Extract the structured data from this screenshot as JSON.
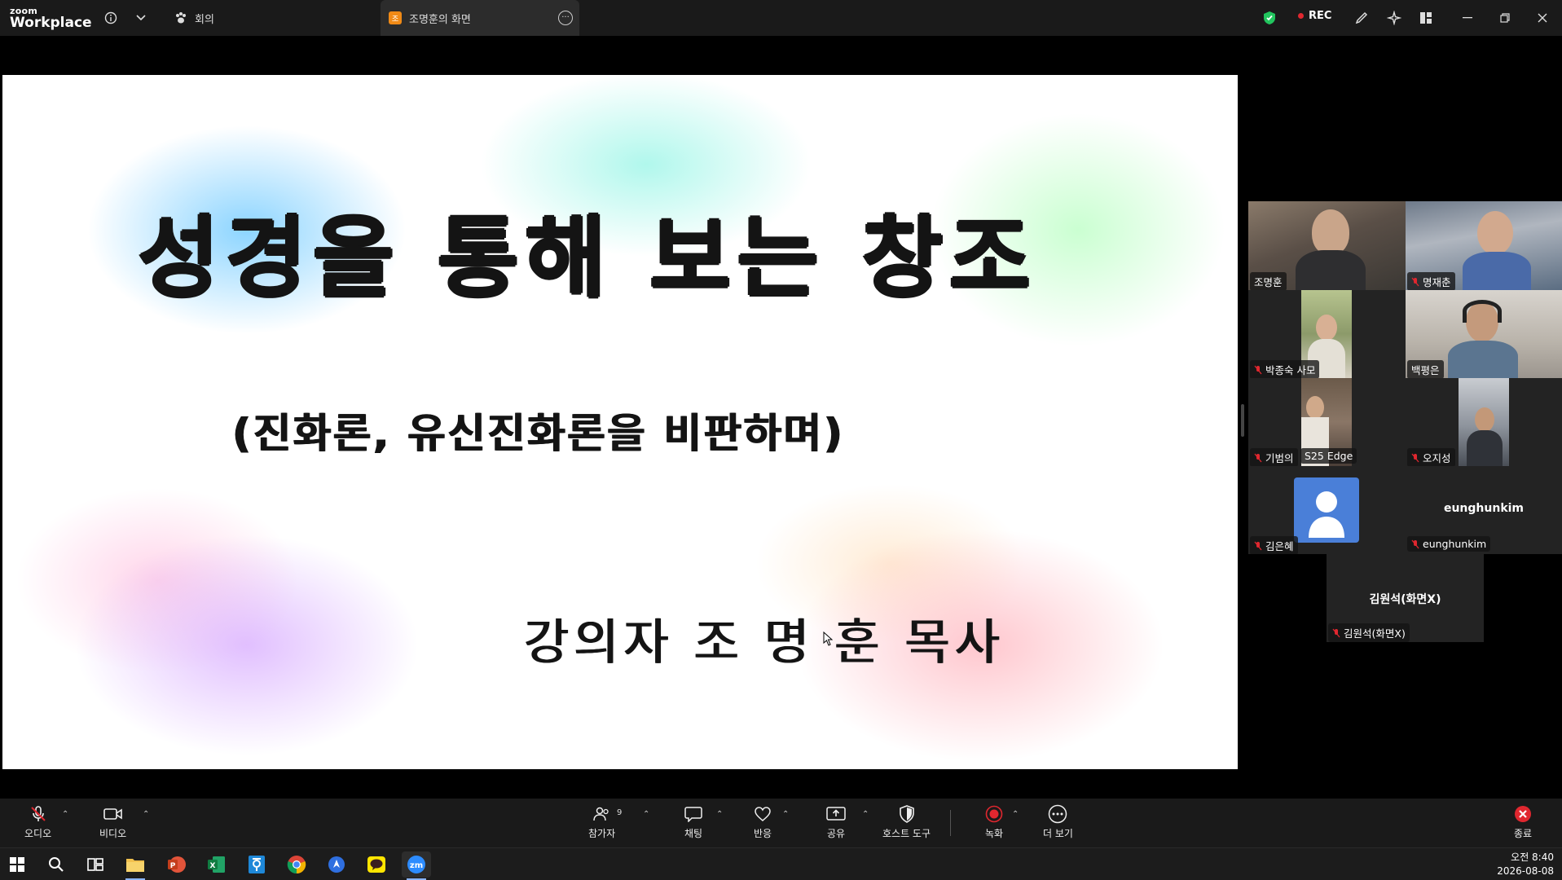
{
  "app": {
    "logo_small": "zoom",
    "logo_big": "Workplace"
  },
  "tabs": {
    "meeting": "회의",
    "share": "조명훈의 화면",
    "share_icon_text": "조"
  },
  "status": {
    "rec": "REC",
    "colors": {
      "rec_dot": "#e0272f",
      "shield": "#22c55e",
      "active_speaker": "#22c55e"
    }
  },
  "slide": {
    "title": "성경을 통해 보는 창조",
    "subtitle": "(진화론, 유신진화론을 비판하며)",
    "lecturer": "강의자  조 명 훈 목사"
  },
  "gallery": [
    {
      "name": "조명훈",
      "muted": false,
      "active": true,
      "video": true
    },
    {
      "name": "명재춘",
      "muted": true,
      "active": false,
      "video": true
    },
    {
      "name": "박종숙 사모",
      "muted": true,
      "active": false,
      "video": true
    },
    {
      "name": "백평은",
      "muted": false,
      "active": false,
      "video": true
    },
    {
      "name": "기범의",
      "extra": "S25 Edge",
      "muted": true,
      "active": false,
      "video": true
    },
    {
      "name": "오지성",
      "muted": true,
      "active": false,
      "video": true
    },
    {
      "name": "김은혜",
      "muted": true,
      "active": false,
      "video": false,
      "avatar": true
    },
    {
      "name": "eunghunkim",
      "center": "eunghunkim",
      "muted": true,
      "active": false,
      "video": false
    },
    {
      "name": "김원석(화면X)",
      "center": "김원석(화면X)",
      "muted": true,
      "active": false,
      "video": false
    }
  ],
  "toolbar": {
    "audio": "오디오",
    "video": "비디오",
    "participants": "참가자",
    "participants_count": "9",
    "chat": "채팅",
    "react": "반응",
    "share": "공유",
    "host_tools": "호스트 도구",
    "record": "녹화",
    "more": "더 보기",
    "end": "종료"
  },
  "taskbar": {
    "time": "오전 8:40",
    "date": "2026-08-08",
    "apps": [
      "windows-start",
      "search",
      "task-view",
      "file-explorer",
      "powerpoint",
      "excel",
      "hangul",
      "chrome",
      "app-blue",
      "kakaotalk",
      "zoom"
    ]
  }
}
